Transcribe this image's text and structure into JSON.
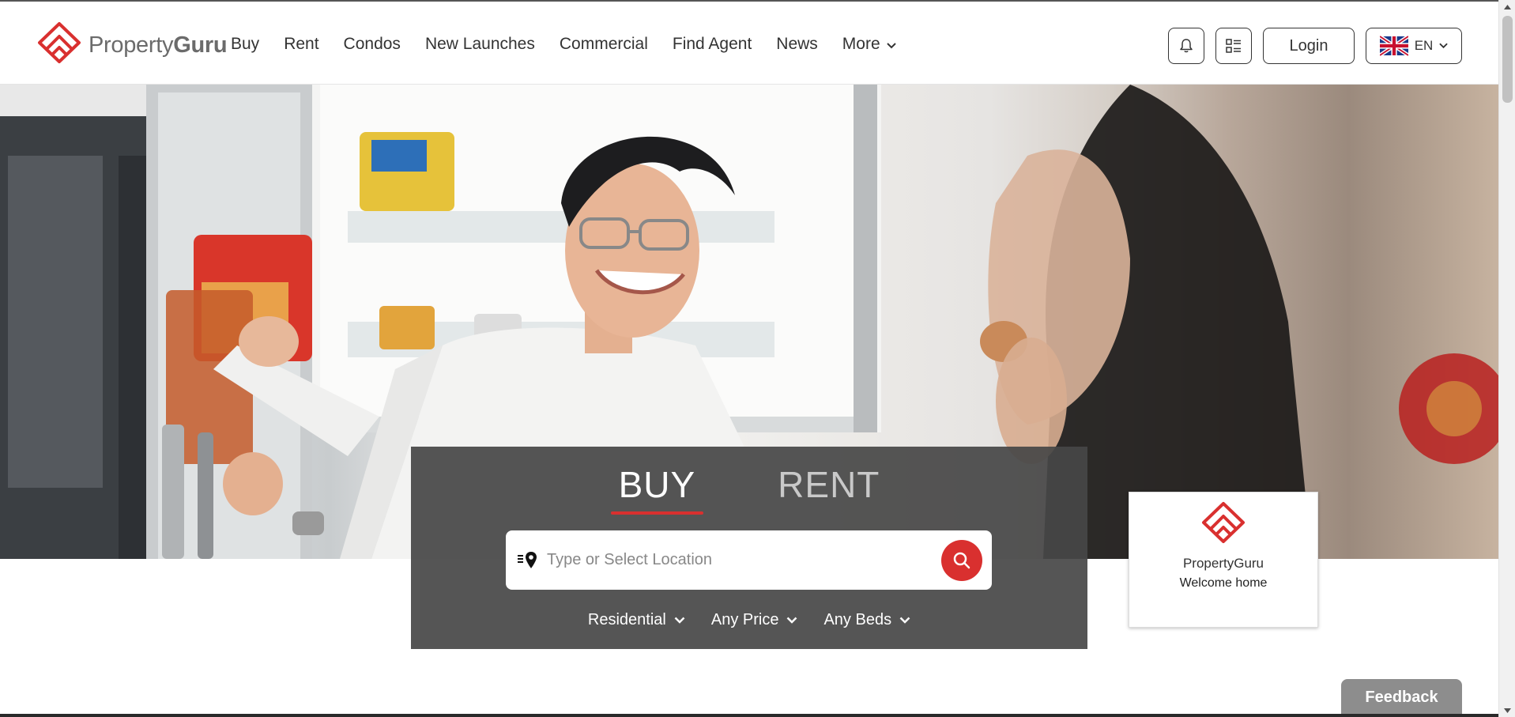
{
  "brand": {
    "name": "PropertyGuru",
    "accent": "#d9302f"
  },
  "nav": {
    "items": [
      {
        "label": "Buy"
      },
      {
        "label": "Rent"
      },
      {
        "label": "Condos"
      },
      {
        "label": "New Launches"
      },
      {
        "label": "Commercial"
      },
      {
        "label": "Find Agent"
      },
      {
        "label": "News"
      },
      {
        "label": "More"
      }
    ]
  },
  "header": {
    "notifications_icon": "bell-icon",
    "shortlist_icon": "list-icon",
    "login_label": "Login",
    "language": "EN",
    "language_flag": "uk-flag-icon"
  },
  "search": {
    "tabs": [
      {
        "label": "BUY",
        "active": true
      },
      {
        "label": "RENT",
        "active": false
      }
    ],
    "placeholder": "Type or Select Location",
    "location_icon": "location-pin-icon",
    "submit_icon": "search-icon",
    "filters": [
      {
        "label": "Residential"
      },
      {
        "label": "Any Price"
      },
      {
        "label": "Any Beds"
      }
    ]
  },
  "welcome_card": {
    "brand": "PropertyGuru",
    "tagline": "Welcome home"
  },
  "feedback": {
    "label": "Feedback"
  }
}
